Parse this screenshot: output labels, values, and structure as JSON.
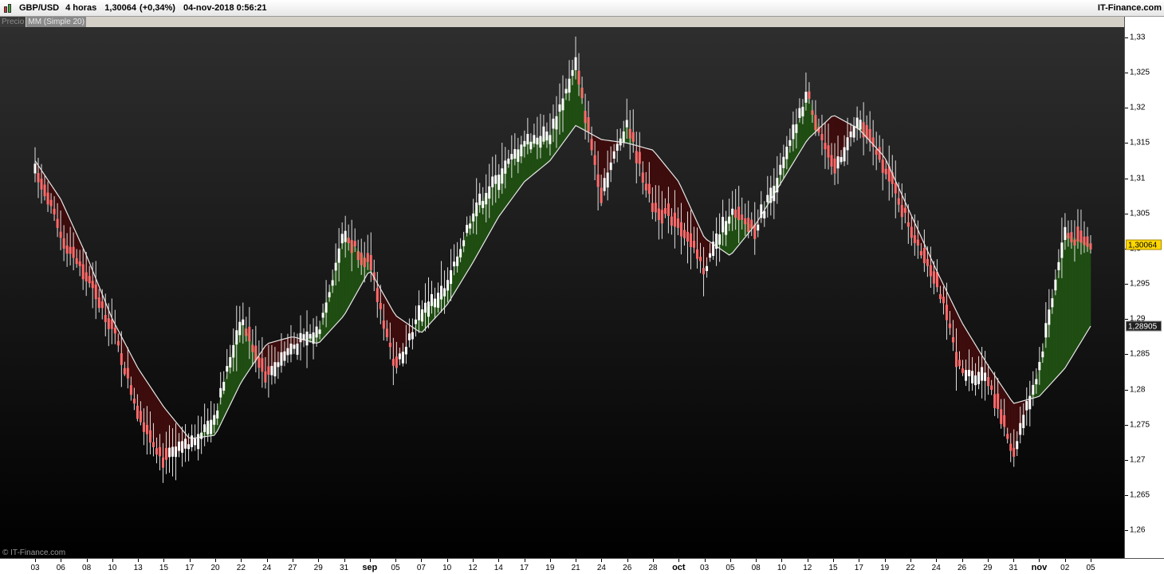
{
  "header": {
    "instrument": "GBP/USD",
    "timeframe": "4 horas",
    "last_price": "1,30064",
    "change": "(+0,34%)",
    "datetime": "04-nov-2018 0:56:21",
    "brand": "IT-Finance.com"
  },
  "legend": {
    "price": "Precio",
    "ma": "MM (Simple 20)"
  },
  "copyright": "© IT-Finance.com",
  "price_tags": {
    "last": "1,30064",
    "ma": "1,28905"
  },
  "colors": {
    "bull_fill": "#1f4d12",
    "bear_fill": "#3d0c0c",
    "ma_line": "#e8e8e8",
    "candle_up": "#ffffff",
    "candle_down": "#ff6b6b"
  },
  "chart_data": {
    "type": "line",
    "title": "",
    "y_axis": {
      "range": [
        1.2555,
        1.3335
      ],
      "ticks": [
        1.26,
        1.265,
        1.27,
        1.275,
        1.28,
        1.285,
        1.29,
        1.295,
        1.3,
        1.305,
        1.31,
        1.315,
        1.32,
        1.325,
        1.33
      ],
      "tick_labels": [
        "1,26",
        "1,265",
        "1,27",
        "1,275",
        "1,28",
        "1,285",
        "1,29",
        "1,295",
        "1,3",
        "1,305",
        "1,31",
        "1,315",
        "1,32",
        "1,325",
        "1,33"
      ]
    },
    "x_axis": {
      "labels": [
        "03",
        "06",
        "08",
        "10",
        "13",
        "15",
        "17",
        "20",
        "22",
        "24",
        "27",
        "29",
        "31",
        "sep",
        "05",
        "07",
        "10",
        "12",
        "14",
        "17",
        "19",
        "21",
        "24",
        "26",
        "28",
        "oct",
        "03",
        "05",
        "08",
        "10",
        "12",
        "15",
        "17",
        "19",
        "22",
        "24",
        "26",
        "29",
        "31",
        "nov",
        "02",
        "05"
      ],
      "month_labels": [
        "sep",
        "oct",
        "nov"
      ]
    },
    "series": [
      {
        "name": "Precio",
        "x": [
          "03",
          "06",
          "08",
          "10",
          "13",
          "15",
          "17",
          "20",
          "22",
          "24",
          "27",
          "29",
          "31",
          "sep",
          "05",
          "07",
          "10",
          "12",
          "14",
          "17",
          "19",
          "21",
          "24",
          "26",
          "28",
          "oct",
          "03",
          "05",
          "08",
          "10",
          "12",
          "15",
          "17",
          "19",
          "22",
          "24",
          "26",
          "29",
          "31",
          "nov",
          "02",
          "05"
        ],
        "values": [
          1.312,
          1.302,
          1.296,
          1.289,
          1.277,
          1.27,
          1.272,
          1.276,
          1.29,
          1.282,
          1.286,
          1.288,
          1.302,
          1.298,
          1.283,
          1.291,
          1.294,
          1.305,
          1.31,
          1.315,
          1.316,
          1.326,
          1.308,
          1.318,
          1.306,
          1.304,
          1.297,
          1.305,
          1.303,
          1.311,
          1.322,
          1.311,
          1.318,
          1.312,
          1.303,
          1.296,
          1.282,
          1.282,
          1.271,
          1.283,
          1.302,
          1.3006
        ]
      },
      {
        "name": "MM (Simple 20)",
        "x": [
          "03",
          "06",
          "08",
          "10",
          "13",
          "15",
          "17",
          "20",
          "22",
          "24",
          "27",
          "29",
          "31",
          "sep",
          "05",
          "07",
          "10",
          "12",
          "14",
          "17",
          "19",
          "21",
          "24",
          "26",
          "28",
          "oct",
          "03",
          "05",
          "08",
          "10",
          "12",
          "15",
          "17",
          "19",
          "22",
          "24",
          "26",
          "29",
          "31",
          "nov",
          "02",
          "05"
        ],
        "values": [
          1.3125,
          1.307,
          1.299,
          1.29,
          1.283,
          1.2775,
          1.273,
          1.2735,
          1.281,
          1.2865,
          1.2875,
          1.2865,
          1.2905,
          1.297,
          1.2905,
          1.288,
          1.292,
          1.298,
          1.3045,
          1.3095,
          1.3125,
          1.3175,
          1.3155,
          1.315,
          1.314,
          1.3095,
          1.3015,
          1.299,
          1.3035,
          1.3095,
          1.3155,
          1.319,
          1.317,
          1.313,
          1.305,
          1.297,
          1.2895,
          1.2835,
          1.278,
          1.279,
          1.283,
          1.289
        ]
      }
    ]
  }
}
